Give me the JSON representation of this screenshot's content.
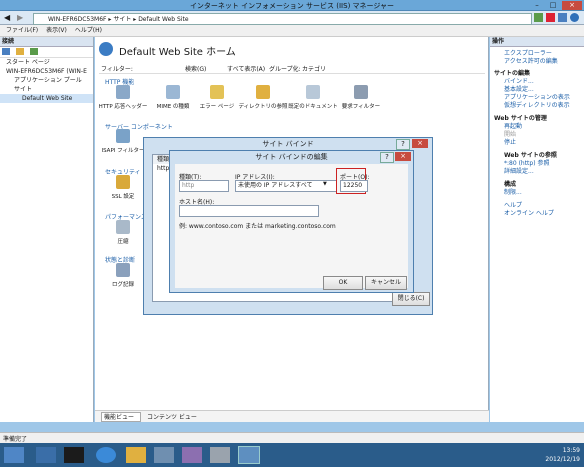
{
  "window": {
    "title": "インターネット インフォメーション サービス (IIS) マネージャー"
  },
  "address": {
    "path": [
      "WIN-EFR6DC53M6F",
      "サイト",
      "Default Web Site"
    ]
  },
  "menu": [
    "ファイル(F)",
    "表示(V)",
    "ヘルプ(H)"
  ],
  "connections": {
    "title": "接続",
    "tree": [
      "スタート ページ",
      "WIN-EFR6DC53M6F (WIN-E",
      "アプリケーション プール",
      "サイト",
      "Default Web Site"
    ]
  },
  "center": {
    "title": "Default Web Site ホーム",
    "filter_label": "フィルター:",
    "filter_go": "検索(G)",
    "filter_showall": "すべて表示(A)",
    "groupby_label": "グループ化:",
    "groupby_value": "カテゴリ",
    "sections": [
      "HTTP 機能",
      "サーバー コンポーネント",
      "セキュリティ",
      "パフォーマンス",
      "状態と診断"
    ],
    "http_features": [
      "HTTP 応答ヘッダー",
      "MIME の種類",
      "エラー ページ",
      "ディレクトリの参照",
      "既定のドキュメント",
      "要求フィルター"
    ],
    "isapi": "ISAPI フィルター",
    "ssl": "SSL 設定",
    "compress": "圧縮",
    "log": "ログ記録",
    "tabs": [
      "機能ビュー",
      "コンテンツ ビュー"
    ]
  },
  "actions": {
    "title": "操作",
    "items": [
      "エクスプローラー",
      "アクセス許可の編集"
    ],
    "site_edit_header": "サイトの編集",
    "site_edit_items": [
      "バインド...",
      "基本設定...",
      "アプリケーションの表示",
      "仮想ディレクトリの表示"
    ],
    "manage_header": "Web サイトの管理",
    "manage_items": [
      "再起動",
      "開始",
      "停止"
    ],
    "browse_header": "Web サイトの参照",
    "browse_items": [
      "*:80 (http) 参照",
      "詳細設定..."
    ],
    "config_header": "構成",
    "config_items": [
      "制限..."
    ],
    "help_items": [
      "ヘルプ",
      "オンライン ヘルプ"
    ]
  },
  "site_binding": {
    "title": "サイト バインド",
    "col_type": "種類",
    "row_type": "http",
    "close_label": "閉じる(C)"
  },
  "edit_binding": {
    "title": "サイト バインドの編集",
    "type_label": "種類(T):",
    "type_value": "http",
    "ip_label": "IP アドレス(I):",
    "ip_value": "未使用の IP アドレスすべて",
    "port_label": "ポート(O):",
    "port_value": "12250",
    "host_label": "ホスト名(H):",
    "host_value": "",
    "example": "例: www.contoso.com または marketing.contoso.com",
    "ok": "OK",
    "cancel": "キャンセル"
  },
  "status": {
    "text": "準備完了"
  },
  "clock": {
    "time": "13:59",
    "date": "2012/12/19"
  },
  "colors": {
    "accent": "#1c5fa8",
    "highlight": "#cc2222",
    "titlebar": "#6aa7d8"
  }
}
